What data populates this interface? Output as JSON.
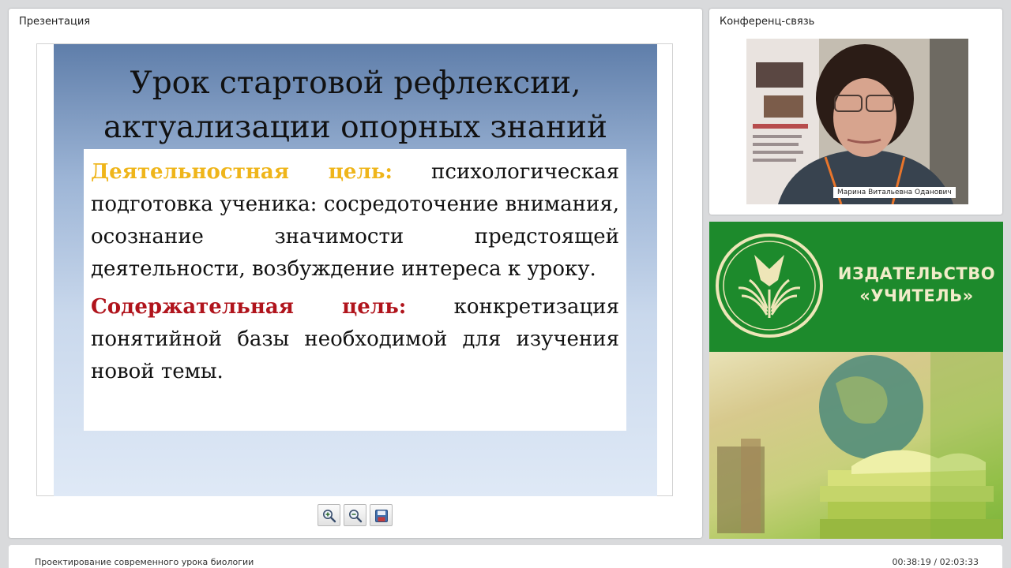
{
  "presentation": {
    "title": "Презентация",
    "slide": {
      "title_line1": "Урок стартовой рефлексии,",
      "title_line2": "актуализации опорных знаний",
      "activity_goal_label": "Деятельностная цель:",
      "activity_goal_text": "психологическая подготовка ученика: сосредоточение внимания, осознание значимости предстоящей деятельности, возбуждение интереса к уроку.",
      "content_goal_label": "Содержательная цель:",
      "content_goal_text": "конкретизация понятийной базы необходимой для изучения новой темы."
    },
    "toolbar": {
      "zoom_in": "zoom-in-icon",
      "zoom_out": "zoom-out-icon",
      "save": "save-icon"
    }
  },
  "conference": {
    "title": "Конференц-связь",
    "speaker_name": "Марина Витальевна Оданович"
  },
  "publisher": {
    "line1": "ИЗДАТЕЛЬСТВО",
    "line2": "«УЧИТЕЛЬ»",
    "colors": {
      "banner": "#1d8a2c",
      "text": "#f2ecc9"
    }
  },
  "footer": {
    "course_title": "Проектирование современного урока биологии",
    "playback_time": "00:38:19 / 02:03:33"
  }
}
